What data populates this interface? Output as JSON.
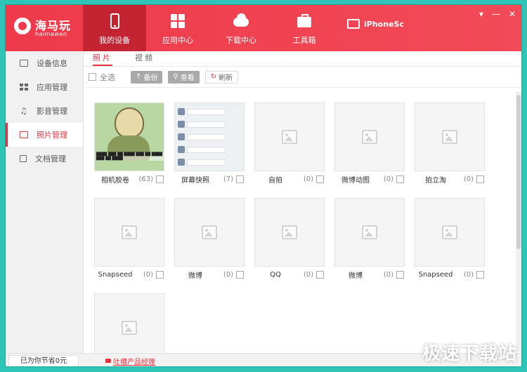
{
  "logo": {
    "brand": "海马玩",
    "sub": "haimawan"
  },
  "nav": [
    {
      "label": "我的设备",
      "icon": "phone-icon",
      "active": true
    },
    {
      "label": "应用中心",
      "icon": "grid-icon",
      "active": false
    },
    {
      "label": "下载中心",
      "icon": "cloud-download-icon",
      "active": false
    },
    {
      "label": "工具箱",
      "icon": "toolbox-icon",
      "active": false
    }
  ],
  "device": {
    "name": "iPhoneSc"
  },
  "window_buttons": {
    "menu": "▾",
    "minimize": "—",
    "close": "✕"
  },
  "sidebar": {
    "items": [
      {
        "label": "设备信息",
        "icon": "monitor-icon"
      },
      {
        "label": "应用管理",
        "icon": "apps-icon"
      },
      {
        "label": "影音管理",
        "icon": "music-icon"
      },
      {
        "label": "照片管理",
        "icon": "photo-icon",
        "active": true
      },
      {
        "label": "文档管理",
        "icon": "document-icon"
      }
    ]
  },
  "tabs": [
    {
      "label": "照片",
      "active": true
    },
    {
      "label": "视频",
      "active": false
    }
  ],
  "toolbar": {
    "select_all": "全选",
    "backup": "备份",
    "view": "查看",
    "refresh": "刷新"
  },
  "albums": [
    {
      "name": "相机胶卷",
      "count": "(63)",
      "thumb": "cartoon"
    },
    {
      "name": "屏幕快照",
      "count": "(7)",
      "thumb": "screenshot"
    },
    {
      "name": "自拍",
      "count": "(0)"
    },
    {
      "name": "微博动图",
      "count": "(0)"
    },
    {
      "name": "拍立淘",
      "count": "(0)"
    },
    {
      "name": "Snapseed",
      "count": "(0)"
    },
    {
      "name": "微博",
      "count": "(0)"
    },
    {
      "name": "QQ",
      "count": "(0)"
    },
    {
      "name": "微博",
      "count": "(0)"
    },
    {
      "name": "Snapseed",
      "count": "(0)"
    },
    {
      "name": "",
      "count": ""
    }
  ],
  "statusbar": {
    "saved": "已为你节省0元",
    "feedback": "吐槽产品经理"
  },
  "watermark": "极速下载站",
  "colors": {
    "brand_red": "#ee3a4b",
    "nav_active": "#c42332",
    "accent": "#e7333f"
  }
}
